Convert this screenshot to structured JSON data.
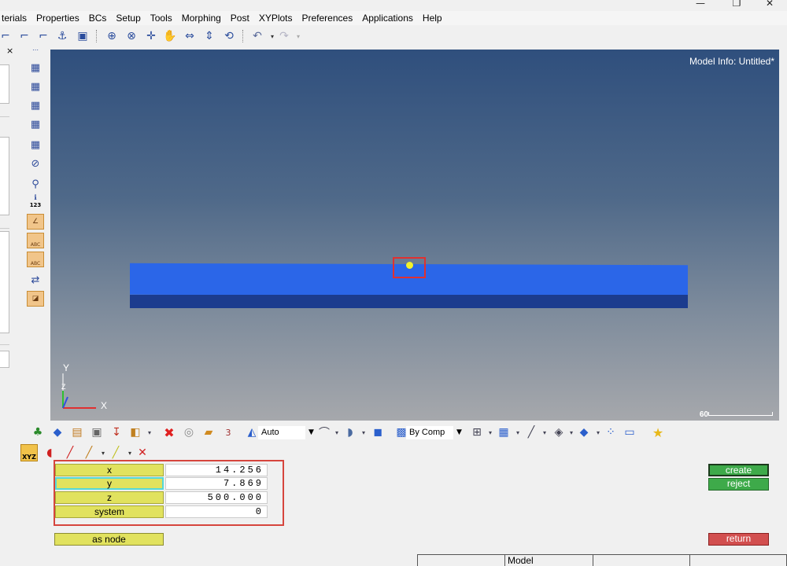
{
  "window": {
    "minimize_icon": "minimize-icon",
    "maximize_icon": "restore-icon",
    "close_icon": "close-icon",
    "minimize_glyph": "—",
    "maximize_glyph": "❐",
    "close_glyph": "✕"
  },
  "menu": {
    "items": [
      "terials",
      "Properties",
      "BCs",
      "Setup",
      "Tools",
      "Morphing",
      "Post",
      "XYPlots",
      "Preferences",
      "Applications",
      "Help"
    ]
  },
  "left_panel": {
    "close_glyph": "×"
  },
  "viewport": {
    "model_info": "Model Info: Untitled*",
    "axis": {
      "y": "Y",
      "z": "Z",
      "x": "X"
    },
    "scale_value": "60",
    "colors": {
      "beam_face": "#2b66e8",
      "beam_side": "#1c3c8e",
      "node": "#f2f22a",
      "highlight": "#e03030"
    }
  },
  "vertical_toolbar": {
    "orange_labels": [
      "ABC",
      "ABC"
    ],
    "info_label": "123"
  },
  "bottom_toolbar": {
    "display_mode": "Auto",
    "color_mode": "By Comp"
  },
  "panel_toolbar": {
    "xyz_label": "XYZ"
  },
  "coords": {
    "x": {
      "label": "x",
      "value": "14.256"
    },
    "y": {
      "label": "y",
      "value": "7.869"
    },
    "z": {
      "label": "z",
      "value": "500.000"
    },
    "system": {
      "label": "system",
      "value": "0"
    }
  },
  "buttons": {
    "as_node": "as node",
    "create": "create",
    "reject": "reject",
    "return": "return"
  },
  "status": {
    "model": "Model"
  }
}
